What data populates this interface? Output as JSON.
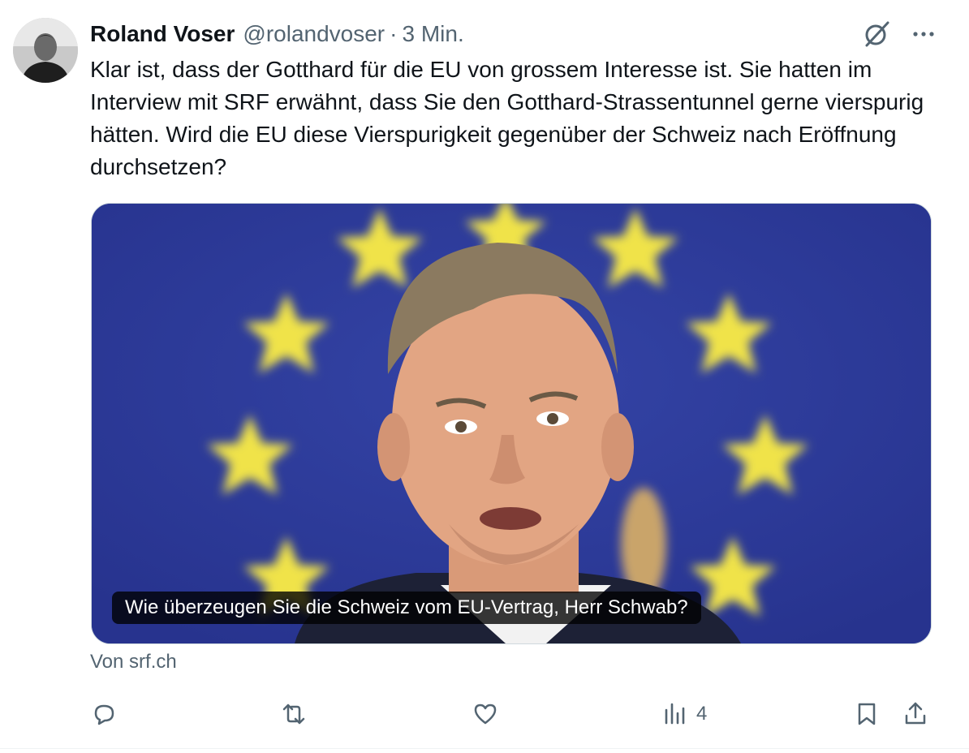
{
  "tweet": {
    "author_name": "Roland Voser",
    "author_handle": "@rolandvoser",
    "separator": "·",
    "time": "3 Min.",
    "text": "Klar ist, dass der Gotthard für die EU von grossem Interesse ist. Sie hatten im Interview mit SRF erwähnt, dass Sie den Gotthard-Strassentunnel gerne vierspurig hätten. Wird die EU diese Vierspurigkeit gegenüber der Schweiz nach Eröffnung durchsetzen?"
  },
  "card": {
    "caption": "Wie überzeugen Sie die Schweiz vom EU-Vertrag, Herr Schwab?",
    "source": "Von srf.ch"
  },
  "actions": {
    "reply_icon": "reply-icon",
    "repost_icon": "repost-icon",
    "like_icon": "like-icon",
    "views_icon": "views-icon",
    "views_count": "4",
    "bookmark_icon": "bookmark-icon",
    "share_icon": "share-icon"
  },
  "colors": {
    "text": "#0f1419",
    "muted": "#536471",
    "eu_blue": "#2c3a99",
    "eu_star": "#f5e642"
  }
}
